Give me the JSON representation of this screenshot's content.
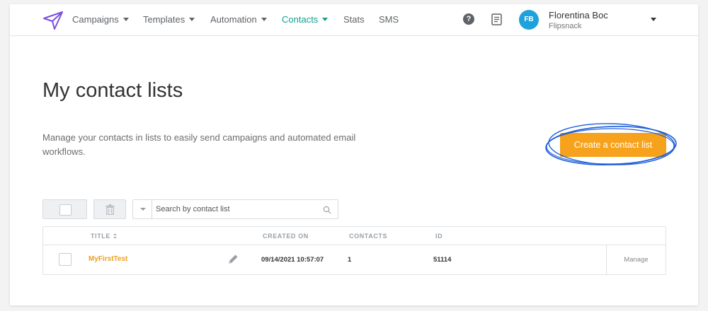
{
  "nav": {
    "items": [
      {
        "label": "Campaigns",
        "dropdown": true
      },
      {
        "label": "Templates",
        "dropdown": true
      },
      {
        "label": "Automation",
        "dropdown": true
      },
      {
        "label": "Contacts",
        "dropdown": true,
        "active": true
      },
      {
        "label": "Stats",
        "dropdown": false
      },
      {
        "label": "SMS",
        "dropdown": false
      }
    ],
    "icons": [
      "logo-icon",
      "help-icon",
      "notes-icon"
    ]
  },
  "user": {
    "initials": "FB",
    "name": "Florentina Boc",
    "company": "Flipsnack",
    "avatar_color": "#1fa2dc"
  },
  "page": {
    "title": "My contact lists",
    "description": "Manage your contacts in lists to easily send campaigns and automated email workflows.",
    "create_button": "Create a contact list"
  },
  "toolbar": {
    "search_placeholder": "Search by contact list"
  },
  "table": {
    "columns": [
      "TITLE",
      "CREATED ON",
      "CONTACTS",
      "ID"
    ],
    "rows": [
      {
        "title": "MyFirstTest",
        "created_on": "09/14/2021 10:57:07",
        "contacts": "1",
        "id": "51114",
        "action": "Manage"
      }
    ]
  },
  "colors": {
    "accent": "#0fa28e",
    "button": "#f7a21c",
    "link": "#f0a01e",
    "annotation": "#1e5fd8"
  }
}
